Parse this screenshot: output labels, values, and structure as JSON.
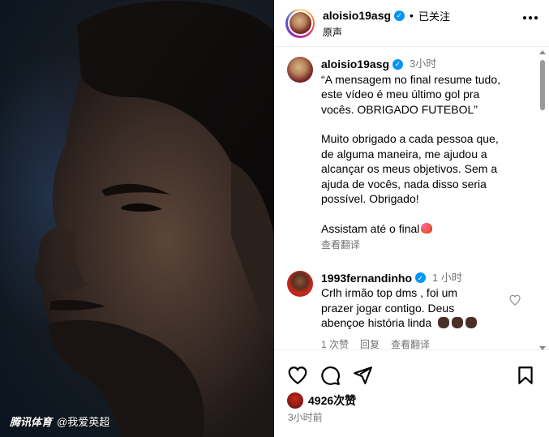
{
  "media": {
    "watermark_brand": "腾讯体育",
    "watermark_account": "@我爱英超"
  },
  "header": {
    "username": "aloisio19asg",
    "separator": "•",
    "follow_state": "已关注",
    "audio": "原声"
  },
  "caption": {
    "username": "aloisio19asg",
    "time": "3小时",
    "lines": [
      "“A mensagem no final resume tudo,",
      "este vídeo é meu último gol pra",
      "vocês. OBRIGADO FUTEBOL”",
      "",
      "Muito obrigado a cada pessoa que,",
      "de alguma maneira, me ajudou a",
      "alcançar os meus objetivos. Sem a",
      "ajuda de vocês, nada disso seria",
      "possível. Obrigado!",
      "",
      "Assistam até o final"
    ],
    "see_translation": "查看翻译"
  },
  "comment": {
    "username": "1993fernandinho",
    "time": "1 小时",
    "lines": [
      "Crlh irmão top dms , foi um",
      "prazer jogar contigo. Deus",
      "abençoe história linda"
    ],
    "likes": "1 次赞",
    "reply": "回复",
    "see_translation": "查看翻译"
  },
  "actions": {
    "likes": "4926次赞",
    "time": "3小时前"
  },
  "icons": [
    "heart-icon",
    "comment-icon",
    "share-icon",
    "bookmark-icon",
    "more-icon",
    "verified-icon"
  ],
  "colors": {
    "verified": "#0095f6",
    "secondary_text": "#737373"
  }
}
